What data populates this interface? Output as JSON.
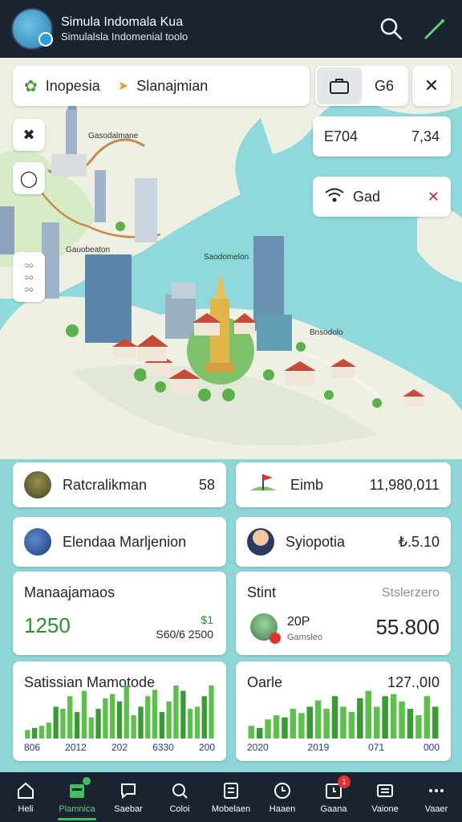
{
  "header": {
    "title": "Simula Indomala Kua",
    "subtitle": "Simulalsla Indomenial toolo"
  },
  "map": {
    "search_left": "Inopesia",
    "search_right": "Slanajmian",
    "tool_value": "G6",
    "stat1_label": "E704",
    "stat1_value": "7,34",
    "wifi_label": "Gad",
    "labels": [
      "Gasodalmane",
      "Gauobeaton",
      "Saodomelon",
      "Bnsodolo"
    ],
    "side_rows": [
      "၁၀",
      "၁၀",
      "၁၀"
    ]
  },
  "cards": {
    "r1_left_label": "Ratcralikman",
    "r1_left_value": "58",
    "r1_right_label": "Eimb",
    "r1_right_value": "11,980,011",
    "r2_left_label": "Elendaa Marljenion",
    "r2_right_label": "Syiopotia",
    "r2_right_value": "₺.5.10",
    "r3_left_title": "Manaajamaos",
    "r3_left_big": "1250",
    "r3_left_delta": "$1",
    "r3_left_sub": "S60/6 2500",
    "r3_right_title": "Stint",
    "r3_right_hint": "Stslerzero",
    "r3_right_code": "20P",
    "r3_right_code_sub": "Gamsleo",
    "r3_right_value": "55.800",
    "r4_left_title": "Satissian Mamotode",
    "r4_left_axis": [
      "806",
      "2012",
      "202",
      "6330",
      "200"
    ],
    "r4_right_title": "Oarle",
    "r4_right_value": "127.,0I0",
    "r4_right_axis": [
      "2020",
      "2019",
      "071",
      "000"
    ]
  },
  "chart_data": [
    {
      "type": "bar",
      "values": [
        8,
        10,
        12,
        15,
        30,
        28,
        40,
        25,
        45,
        20,
        28,
        38,
        42,
        35,
        50,
        22,
        30,
        40,
        46,
        25,
        35,
        50,
        45,
        28,
        30,
        40,
        50
      ],
      "ylim": [
        0,
        50
      ]
    },
    {
      "type": "bar",
      "values": [
        12,
        10,
        18,
        22,
        20,
        28,
        24,
        30,
        36,
        28,
        40,
        30,
        25,
        38,
        45,
        30,
        40,
        42,
        35,
        28,
        22,
        40,
        30
      ],
      "ylim": [
        0,
        50
      ]
    }
  ],
  "nav": [
    {
      "label": "Heli",
      "icon": "home-icon"
    },
    {
      "label": "Plamnica",
      "icon": "calendar-icon"
    },
    {
      "label": "Saebar",
      "icon": "chat-icon"
    },
    {
      "label": "Coloi",
      "icon": "search-icon"
    },
    {
      "label": "Mobelaen",
      "icon": "checklist-icon"
    },
    {
      "label": "Haaen",
      "icon": "clock-icon"
    },
    {
      "label": "Gaana",
      "icon": "timer-icon",
      "badge": "1"
    },
    {
      "label": "Vaione",
      "icon": "trade-icon"
    },
    {
      "label": "Vaaer",
      "icon": "more-icon"
    }
  ],
  "colors": {
    "bar_green": "#5cc04a",
    "bar_dark": "#3a9a35",
    "accent": "#3fbf5f"
  }
}
